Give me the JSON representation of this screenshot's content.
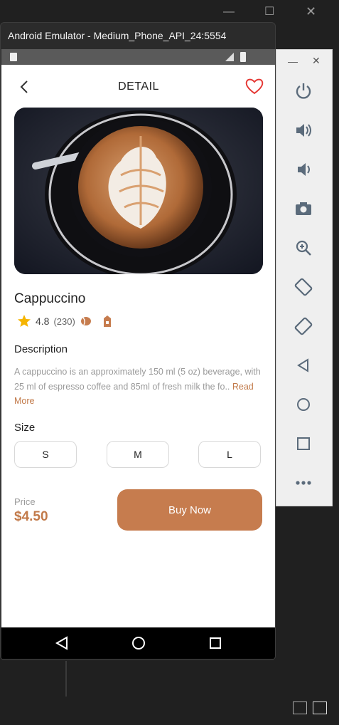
{
  "emulator": {
    "window_title": "Android Emulator - Medium_Phone_API_24:5554"
  },
  "app": {
    "header_title": "DETAIL",
    "product": {
      "name": "Cappuccino",
      "rating": "4.8",
      "review_count": "(230)"
    },
    "description": {
      "heading": "Description",
      "text": "A cappuccino is an approximately 150 ml (5 oz) beverage, with 25 ml of espresso coffee and 85ml of fresh milk the fo.. ",
      "read_more": "Read More"
    },
    "size": {
      "heading": "Size",
      "options": [
        "S",
        "M",
        "L"
      ]
    },
    "price": {
      "label": "Price",
      "value": "$4.50"
    },
    "buy_button": "Buy Now"
  },
  "colors": {
    "accent": "#C67C4E",
    "price": "#C27A4A",
    "favorite": "#E53935"
  },
  "side_panel_icons": [
    "power-icon",
    "volume-up-icon",
    "volume-down-icon",
    "camera-icon",
    "zoom-icon",
    "rotate-left-icon",
    "rotate-right-icon",
    "back-icon",
    "home-icon",
    "overview-icon",
    "more-icon"
  ]
}
